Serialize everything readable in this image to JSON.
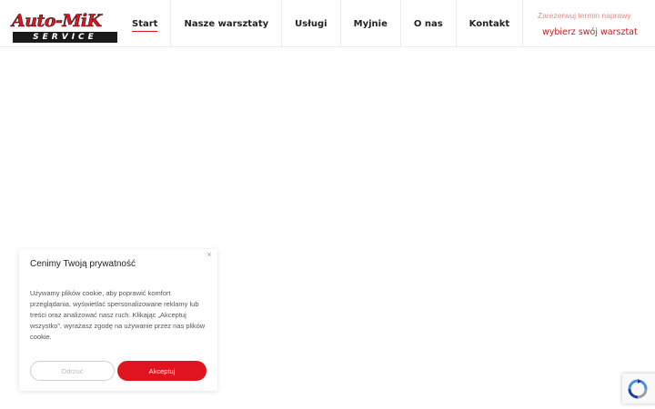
{
  "header": {
    "logo": {
      "top_text": "Auto-MiK",
      "bottom_text": "SERVICE"
    },
    "nav": [
      {
        "label": "Start",
        "active": true
      },
      {
        "label": "Nasze warsztaty"
      },
      {
        "label": "Usługi"
      },
      {
        "label": "Myjnie"
      },
      {
        "label": "O nas"
      },
      {
        "label": "Kontakt"
      }
    ],
    "cta": {
      "note": "Zarezerwuj termin naprawy",
      "link": "wybierz swój warsztat",
      "icon": "hand-pointer-icon"
    }
  },
  "cookie": {
    "title": "Cenimy Twoją prywatność",
    "text": "Używamy plików cookie, aby poprawić komfort przeglądania, wyświetlać spersonalizowane reklamy lub treści oraz analizować nasz ruch. Klikając „Akceptuj wszystko”, wyrażasz zgodę na używanie przez nas plików cookie.",
    "reject_label": "Odrzuć",
    "accept_label": "Akceptuj",
    "close_symbol": "×"
  },
  "colors": {
    "brand_red": "#e0141e",
    "text_dark": "#222222"
  }
}
